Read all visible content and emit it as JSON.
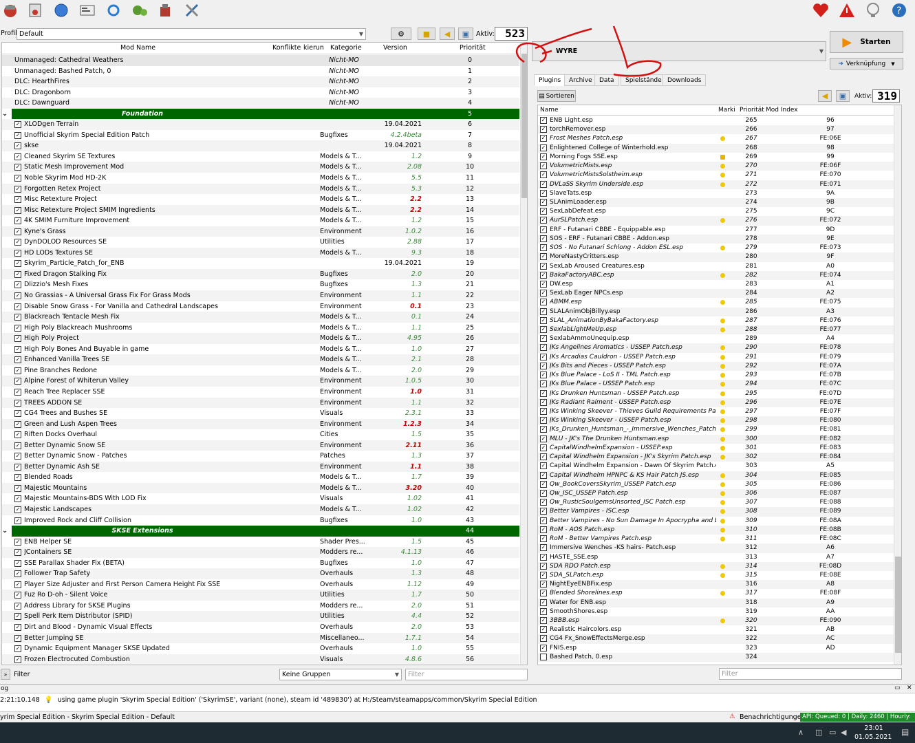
{
  "toolbar": {
    "icons": [
      "install-mod-icon",
      "nexus-icon",
      "globe-icon",
      "profiles-icon",
      "refresh-icon",
      "executables-icon",
      "tools-icon",
      "settings-icon"
    ],
    "right_icons": [
      "endorse-heart-icon",
      "warning-icon",
      "update-icon",
      "help-icon"
    ]
  },
  "profile": {
    "label": "Profil",
    "value": "Default",
    "active_label": "Aktiv:",
    "active_count": "523"
  },
  "mod_columns": {
    "name": "Mod Name",
    "conflicts": "Konflikte",
    "flags": "kierun",
    "category": "Kategorie",
    "version": "Version",
    "priority": "Priorität"
  },
  "mods": [
    {
      "name": "Unmanaged: Cathedral Weathers",
      "cat": "Nicht-MO",
      "ver": "",
      "pri": "0",
      "type": "unmanaged",
      "sel": true
    },
    {
      "name": "Unmanaged: Bashed Patch, 0",
      "cat": "Nicht-MO",
      "ver": "",
      "pri": "1",
      "type": "unmanaged"
    },
    {
      "name": "DLC: HearthFires",
      "cat": "Nicht-MO",
      "ver": "",
      "pri": "2",
      "type": "unmanaged"
    },
    {
      "name": "DLC: Dragonborn",
      "cat": "Nicht-MO",
      "ver": "",
      "pri": "3",
      "type": "unmanaged"
    },
    {
      "name": "DLC: Dawnguard",
      "cat": "Nicht-MO",
      "ver": "",
      "pri": "4",
      "type": "unmanaged"
    },
    {
      "name": "Foundation",
      "cat": "",
      "ver": "",
      "pri": "5",
      "type": "sep"
    },
    {
      "name": "XLODgen Terrain",
      "cat": "",
      "ver": "19.04.2021",
      "vc": "blk",
      "pri": "6"
    },
    {
      "name": "Unofficial Skyrim Special Edition Patch",
      "cat": "Bugfixes",
      "ver": "4.2.4beta",
      "pri": "7"
    },
    {
      "name": "skse",
      "cat": "",
      "ver": "19.04.2021",
      "vc": "blk",
      "pri": "8"
    },
    {
      "name": "Cleaned Skyrim SE Textures",
      "cat": "Models & T...",
      "ver": "1.2",
      "pri": "9"
    },
    {
      "name": "Static Mesh Improvement Mod",
      "cat": "Models & T...",
      "ver": "2.08",
      "pri": "10"
    },
    {
      "name": "Noble Skyrim Mod HD-2K",
      "cat": "Models & T...",
      "ver": "5.5",
      "pri": "11"
    },
    {
      "name": "Forgotten Retex Project",
      "cat": "Models & T...",
      "ver": "5.3",
      "pri": "12"
    },
    {
      "name": "Misc Retexture Project",
      "cat": "Models & T...",
      "ver": "2.2",
      "vc": "red",
      "pri": "13"
    },
    {
      "name": "Misc Retexture Project SMIM Ingredients",
      "cat": "Models & T...",
      "ver": "2.2",
      "vc": "red",
      "pri": "14"
    },
    {
      "name": "4K SMIM Furniture Improvement",
      "cat": "Models & T...",
      "ver": "1.2",
      "pri": "15"
    },
    {
      "name": "Kyne's Grass",
      "cat": "Environment",
      "ver": "1.0.2",
      "pri": "16"
    },
    {
      "name": "DynDOLOD Resources SE",
      "cat": "Utilities",
      "ver": "2.88",
      "pri": "17"
    },
    {
      "name": "HD LODs Textures SE",
      "cat": "Models & T...",
      "ver": "9.3",
      "pri": "18"
    },
    {
      "name": "Skyrim_Particle_Patch_for_ENB",
      "cat": "",
      "ver": "19.04.2021",
      "vc": "blk",
      "pri": "19"
    },
    {
      "name": "Fixed Dragon Stalking Fix",
      "cat": "Bugfixes",
      "ver": "2.0",
      "pri": "20"
    },
    {
      "name": "Dlizzio's Mesh Fixes",
      "cat": "Bugfixes",
      "ver": "1.3",
      "pri": "21"
    },
    {
      "name": "No Grassias - A Universal Grass Fix For Grass Mods",
      "cat": "Environment",
      "ver": "1.1",
      "pri": "22"
    },
    {
      "name": "Disable Snow Grass - For Vanilla and Cathedral Landscapes",
      "cat": "Environment",
      "ver": "0.1",
      "vc": "red",
      "pri": "23"
    },
    {
      "name": "Blackreach Tentacle Mesh Fix",
      "cat": "Models & T...",
      "ver": "0.1",
      "pri": "24"
    },
    {
      "name": "High Poly Blackreach Mushrooms",
      "cat": "Models & T...",
      "ver": "1.1",
      "pri": "25"
    },
    {
      "name": "High Poly Project",
      "cat": "Models & T...",
      "ver": "4.95",
      "pri": "26"
    },
    {
      "name": "High Poly Bones And Buyable in game",
      "cat": "Models & T...",
      "ver": "1.0",
      "pri": "27"
    },
    {
      "name": "Enhanced Vanilla Trees SE",
      "cat": "Models & T...",
      "ver": "2.1",
      "pri": "28"
    },
    {
      "name": "Pine Branches Redone",
      "cat": "Models & T...",
      "ver": "2.0",
      "pri": "29"
    },
    {
      "name": "Alpine Forest of Whiterun Valley",
      "cat": "Environment",
      "ver": "1.0.5",
      "pri": "30"
    },
    {
      "name": "Reach Tree Replacer SSE",
      "cat": "Environment",
      "ver": "1.0",
      "vc": "red",
      "pri": "31"
    },
    {
      "name": "TREES ADDON SE",
      "cat": "Environment",
      "ver": "1.1",
      "pri": "32"
    },
    {
      "name": "CG4 Trees and Bushes SE",
      "cat": "Visuals",
      "ver": "2.3.1",
      "pri": "33"
    },
    {
      "name": "Green and Lush Aspen Trees",
      "cat": "Environment",
      "ver": "1.2.3",
      "vc": "red",
      "pri": "34"
    },
    {
      "name": "Riften Docks Overhaul",
      "cat": "Cities",
      "ver": "1.5",
      "pri": "35"
    },
    {
      "name": "Better Dynamic Snow SE",
      "cat": "Environment",
      "ver": "2.11",
      "vc": "red",
      "pri": "36"
    },
    {
      "name": "Better Dynamic Snow - Patches",
      "cat": "Patches",
      "ver": "1.3",
      "pri": "37"
    },
    {
      "name": "Better Dynamic Ash SE",
      "cat": "Environment",
      "ver": "1.1",
      "vc": "red",
      "pri": "38"
    },
    {
      "name": "Blended Roads",
      "cat": "Models & T...",
      "ver": "1.7",
      "pri": "39"
    },
    {
      "name": "Majestic Mountains",
      "cat": "Models & T...",
      "ver": "3.20",
      "vc": "red",
      "pri": "40"
    },
    {
      "name": "Majestic Mountains-BDS With LOD Fix",
      "cat": "Visuals",
      "ver": "1.02",
      "pri": "41"
    },
    {
      "name": "Majestic Landscapes",
      "cat": "Models & T...",
      "ver": "1.02",
      "pri": "42"
    },
    {
      "name": "Improved Rock and Cliff Collision",
      "cat": "Bugfixes",
      "ver": "1.0",
      "pri": "43"
    },
    {
      "name": "SKSE Extensions",
      "cat": "",
      "ver": "",
      "pri": "44",
      "type": "sep"
    },
    {
      "name": "ENB Helper SE",
      "cat": "Shader Pres...",
      "ver": "1.5",
      "pri": "45"
    },
    {
      "name": "JContainers SE",
      "cat": "Modders re...",
      "ver": "4.1.13",
      "pri": "46"
    },
    {
      "name": "SSE Parallax Shader Fix (BETA)",
      "cat": "Bugfixes",
      "ver": "1.0",
      "pri": "47"
    },
    {
      "name": "Follower Trap Safety",
      "cat": "Overhauls",
      "ver": "1.3",
      "pri": "48"
    },
    {
      "name": "Player Size Adjuster and First Person Camera Height Fix SSE",
      "cat": "Overhauls",
      "ver": "1.12",
      "pri": "49"
    },
    {
      "name": "Fuz Ro D-oh - Silent Voice",
      "cat": "Utilities",
      "ver": "1.7",
      "pri": "50"
    },
    {
      "name": "Address Library for SKSE Plugins",
      "cat": "Modders re...",
      "ver": "2.0",
      "pri": "51"
    },
    {
      "name": "Spell Perk Item Distributor (SPID)",
      "cat": "Utilities",
      "ver": "4.4",
      "pri": "52"
    },
    {
      "name": "Dirt and Blood - Dynamic Visual Effects",
      "cat": "Overhauls",
      "ver": "2.0",
      "pri": "53"
    },
    {
      "name": "Better Jumping SE",
      "cat": "Miscellaneo...",
      "ver": "1.7.1",
      "pri": "54"
    },
    {
      "name": "Dynamic Equipment Manager SKSE Updated",
      "cat": "Overhauls",
      "ver": "1.0",
      "pri": "55"
    },
    {
      "name": "Frozen Electrocuted Combustion",
      "cat": "Visuals",
      "ver": "4.8.6",
      "pri": "56"
    }
  ],
  "filter": {
    "label": "Filter",
    "groups": "Keine Gruppen",
    "placeholder": "Filter"
  },
  "launch": {
    "exe": "WYRE",
    "start": "Starten",
    "shortcut": "Verknüpfung"
  },
  "tabs": [
    "Plugins",
    "Archive",
    "Data",
    "Spielstände",
    "Downloads"
  ],
  "plugins_bar": {
    "sort": "Sortieren",
    "active_label": "Aktiv:",
    "active_count": "319"
  },
  "plugin_columns": {
    "name": "Name",
    "flags": "Marki",
    "priority": "Priorität",
    "index": "Mod Index"
  },
  "plugins": [
    {
      "n": "ENB Light.esp",
      "p": "265",
      "i": "96"
    },
    {
      "n": "torchRemover.esp",
      "p": "266",
      "i": "97"
    },
    {
      "n": "Frost Meshes Patch.esp",
      "p": "267",
      "i": "FE:06E",
      "l": 1,
      "d": 1
    },
    {
      "n": "Enlightened College of Winterhold.esp",
      "p": "268",
      "i": "98"
    },
    {
      "n": "Morning Fogs SSE.esp",
      "p": "269",
      "i": "99",
      "d": 2
    },
    {
      "n": "VolumetricMists.esp",
      "p": "270",
      "i": "FE:06F",
      "l": 1,
      "d": 1
    },
    {
      "n": "VolumetricMistsSolstheim.esp",
      "p": "271",
      "i": "FE:070",
      "l": 1,
      "d": 1
    },
    {
      "n": "DVLaSS Skyrim Underside.esp",
      "p": "272",
      "i": "FE:071",
      "l": 1,
      "d": 1
    },
    {
      "n": "SlaveTats.esp",
      "p": "273",
      "i": "9A"
    },
    {
      "n": "SLAnimLoader.esp",
      "p": "274",
      "i": "9B"
    },
    {
      "n": "SexLabDefeat.esp",
      "p": "275",
      "i": "9C"
    },
    {
      "n": "AurSLPatch.esp",
      "p": "276",
      "i": "FE:072",
      "l": 1,
      "d": 1
    },
    {
      "n": "ERF - Futanari CBBE - Equippable.esp",
      "p": "277",
      "i": "9D"
    },
    {
      "n": "SOS - ERF - Futanari CBBE - Addon.esp",
      "p": "278",
      "i": "9E"
    },
    {
      "n": "SOS - No Futanari Schlong - Addon ESL.esp",
      "p": "279",
      "i": "FE:073",
      "l": 1,
      "d": 1
    },
    {
      "n": "MoreNastyCritters.esp",
      "p": "280",
      "i": "9F"
    },
    {
      "n": "SexLab Aroused Creatures.esp",
      "p": "281",
      "i": "A0"
    },
    {
      "n": "BakaFactoryABC.esp",
      "p": "282",
      "i": "FE:074",
      "l": 1,
      "d": 1
    },
    {
      "n": "DW.esp",
      "p": "283",
      "i": "A1"
    },
    {
      "n": "SexLab Eager NPCs.esp",
      "p": "284",
      "i": "A2"
    },
    {
      "n": "ABMM.esp",
      "p": "285",
      "i": "FE:075",
      "l": 1,
      "d": 1
    },
    {
      "n": "SLALAnimObjBillyy.esp",
      "p": "286",
      "i": "A3"
    },
    {
      "n": "SLAL_AnimationByBakaFactory.esp",
      "p": "287",
      "i": "FE:076",
      "l": 1,
      "d": 1
    },
    {
      "n": "SexlabLightMeUp.esp",
      "p": "288",
      "i": "FE:077",
      "l": 1,
      "d": 1
    },
    {
      "n": "SexlabAmmoUnequip.esp",
      "p": "289",
      "i": "A4"
    },
    {
      "n": "JKs Angelines Aromatics - USSEP Patch.esp",
      "p": "290",
      "i": "FE:078",
      "l": 1,
      "d": 1
    },
    {
      "n": "JKs Arcadias Cauldron - USSEP Patch.esp",
      "p": "291",
      "i": "FE:079",
      "l": 1,
      "d": 1
    },
    {
      "n": "JKs Bits and Pieces - USSEP Patch.esp",
      "p": "292",
      "i": "FE:07A",
      "l": 1,
      "d": 1
    },
    {
      "n": "JKs Blue Palace - LoS II - TML Patch.esp",
      "p": "293",
      "i": "FE:07B",
      "l": 1,
      "d": 1
    },
    {
      "n": "JKs Blue Palace - USSEP Patch.esp",
      "p": "294",
      "i": "FE:07C",
      "l": 1,
      "d": 1
    },
    {
      "n": "JKs Drunken Huntsman - USSEP Patch.esp",
      "p": "295",
      "i": "FE:07D",
      "l": 1,
      "d": 1
    },
    {
      "n": "JKs Radiant Raiment - USSEP Patch.esp",
      "p": "296",
      "i": "FE:07E",
      "l": 1,
      "d": 1
    },
    {
      "n": "JKs Winking Skeever - Thieves Guild Requirements Patch....",
      "p": "297",
      "i": "FE:07F",
      "l": 1,
      "d": 1
    },
    {
      "n": "JKs Winking Skeever - USSEP Patch.esp",
      "p": "298",
      "i": "FE:080",
      "l": 1,
      "d": 1
    },
    {
      "n": "JKs_Drunken_Huntsman_-_Immersive_Wenches_Patch.esp",
      "p": "299",
      "i": "FE:081",
      "l": 1,
      "d": 1
    },
    {
      "n": "MLU - JK's The Drunken Huntsman.esp",
      "p": "300",
      "i": "FE:082",
      "l": 1,
      "d": 1
    },
    {
      "n": "CapitalWindhelmExpansion - USSEP.esp",
      "p": "301",
      "i": "FE:083",
      "l": 1,
      "d": 1
    },
    {
      "n": "Capital Windhelm Expansion - JK's Skyrim Patch.esp",
      "p": "302",
      "i": "FE:084",
      "l": 1,
      "d": 1
    },
    {
      "n": "Capital Windhelm Expansion - Dawn Of Skyrim Patch.esp",
      "p": "303",
      "i": "A5"
    },
    {
      "n": "Capital Windhelm HPNPC & KS Hair Patch JS.esp",
      "p": "304",
      "i": "FE:085",
      "l": 1,
      "d": 1
    },
    {
      "n": "Qw_BookCoversSkyrim_USSEP Patch.esp",
      "p": "305",
      "i": "FE:086",
      "l": 1,
      "d": 1
    },
    {
      "n": "Qw_ISC_USSEP Patch.esp",
      "p": "306",
      "i": "FE:087",
      "l": 1,
      "d": 1
    },
    {
      "n": "Qw_RusticSoulgemsUnsorted_ISC Patch.esp",
      "p": "307",
      "i": "FE:088",
      "l": 1,
      "d": 1
    },
    {
      "n": "Better Vampires - ISC.esp",
      "p": "308",
      "i": "FE:089",
      "l": 1,
      "d": 1
    },
    {
      "n": "Better Vampires - No Sun Damage In Apocrypha and Bo...",
      "p": "309",
      "i": "FE:08A",
      "l": 1,
      "d": 1
    },
    {
      "n": "RoM - AOS Patch.esp",
      "p": "310",
      "i": "FE:08B",
      "l": 1,
      "d": 1
    },
    {
      "n": "RoM - Better Vampires Patch.esp",
      "p": "311",
      "i": "FE:08C",
      "l": 1,
      "d": 1
    },
    {
      "n": "Immersive Wenches -KS hairs- Patch.esp",
      "p": "312",
      "i": "A6"
    },
    {
      "n": "HASTE_SSE.esp",
      "p": "313",
      "i": "A7"
    },
    {
      "n": "SDA RDO Patch.esp",
      "p": "314",
      "i": "FE:08D",
      "l": 1,
      "d": 1
    },
    {
      "n": "SDA_SLPatch.esp",
      "p": "315",
      "i": "FE:08E",
      "l": 1,
      "d": 1
    },
    {
      "n": "NightEyeENBFix.esp",
      "p": "316",
      "i": "A8"
    },
    {
      "n": "Blended Shorelines.esp",
      "p": "317",
      "i": "FE:08F",
      "l": 1,
      "d": 1
    },
    {
      "n": "Water for ENB.esp",
      "p": "318",
      "i": "A9"
    },
    {
      "n": "SmoothShores.esp",
      "p": "319",
      "i": "AA"
    },
    {
      "n": "3BBB.esp",
      "p": "320",
      "i": "FE:090",
      "l": 1,
      "d": 1
    },
    {
      "n": "Realistic Haircolors.esp",
      "p": "321",
      "i": "AB"
    },
    {
      "n": "CG4 Fx_SnowEffectsMerge.esp",
      "p": "322",
      "i": "AC"
    },
    {
      "n": "FNIS.esp",
      "p": "323",
      "i": "AD"
    },
    {
      "n": "Bashed Patch, 0.esp",
      "p": "324",
      "i": "",
      "unchecked": 1
    }
  ],
  "plugin_filter": {
    "placeholder": "Filter"
  },
  "log": {
    "title": "og",
    "line": "2:21:10.148",
    "message": "using game plugin 'Skyrim Special Edition' ('SkyrimSE', variant (none), steam id '489830') at H:/Steam/steamapps/common/Skyrim Special Edition"
  },
  "status": {
    "title": "yrim Special Edition - Skyrim Special Edition - Default",
    "notifications": "Benachrichtigungen",
    "api": "API: Queued: 0 | Daily: 2460 | Hourly: 100"
  },
  "taskbar": {
    "time": "23:01",
    "date": "01.05.2021"
  }
}
